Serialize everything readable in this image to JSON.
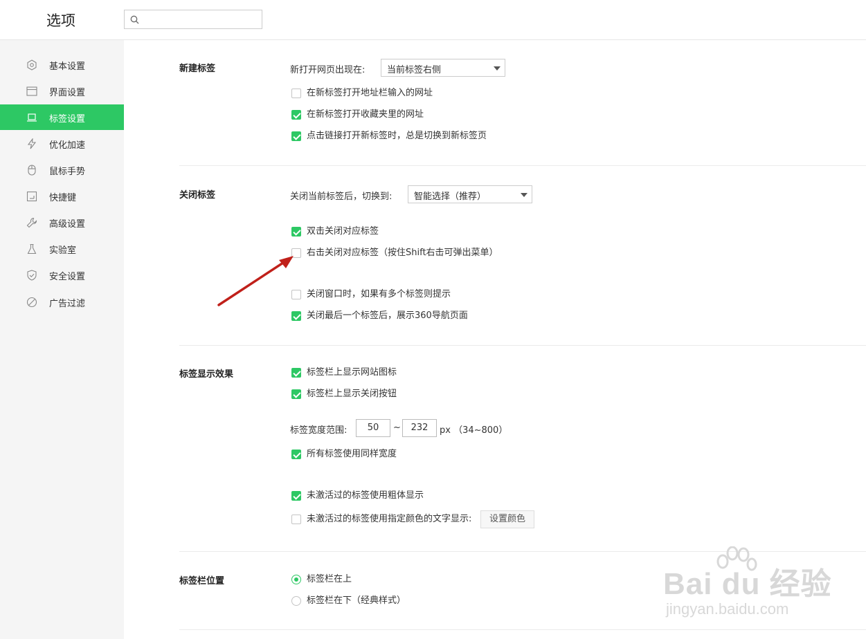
{
  "header": {
    "title": "选项",
    "search": {
      "placeholder": ""
    }
  },
  "sidebar": {
    "items": [
      {
        "label": "基本设置",
        "icon": "settings-icon"
      },
      {
        "label": "界面设置",
        "icon": "window-icon"
      },
      {
        "label": "标签设置",
        "icon": "tab-icon",
        "active": true
      },
      {
        "label": "优化加速",
        "icon": "lightning-icon"
      },
      {
        "label": "鼠标手势",
        "icon": "mouse-icon"
      },
      {
        "label": "快捷键",
        "icon": "keyboard-icon"
      },
      {
        "label": "高级设置",
        "icon": "wrench-icon"
      },
      {
        "label": "实验室",
        "icon": "flask-icon"
      },
      {
        "label": "安全设置",
        "icon": "shield-icon"
      },
      {
        "label": "广告过滤",
        "icon": "block-icon"
      }
    ]
  },
  "sections": {
    "new_tab": {
      "title": "新建标签",
      "open_position_label": "新打开网页出现在:",
      "open_position_value": "当前标签右侧",
      "options": [
        {
          "label": "在新标签打开地址栏输入的网址",
          "checked": false
        },
        {
          "label": "在新标签打开收藏夹里的网址",
          "checked": true
        },
        {
          "label": "点击链接打开新标签时，总是切换到新标签页",
          "checked": true
        }
      ]
    },
    "close_tab": {
      "title": "关闭标签",
      "switch_label": "关闭当前标签后，切换到:",
      "switch_value": "智能选择（推荐）",
      "options": [
        {
          "label": "双击关闭对应标签",
          "checked": true
        },
        {
          "label": "右击关闭对应标签（按住Shift右击可弹出菜单）",
          "checked": false
        },
        {
          "label": "关闭窗口时，如果有多个标签则提示",
          "checked": false
        },
        {
          "label": "关闭最后一个标签后，展示360导航页面",
          "checked": true
        }
      ]
    },
    "display": {
      "title": "标签显示效果",
      "options": [
        {
          "label": "标签栏上显示网站图标",
          "checked": true
        },
        {
          "label": "标签栏上显示关闭按钮",
          "checked": true
        }
      ],
      "width_label": "标签宽度范围:",
      "width_min": "50",
      "width_sep": "~",
      "width_max": "232",
      "width_unit": "px （34~800）",
      "same_width": {
        "label": "所有标签使用同样宽度",
        "checked": true
      },
      "bold_inactive": {
        "label": "未激活过的标签使用粗体显示",
        "checked": true
      },
      "color_inactive": {
        "label": "未激活过的标签使用指定颜色的文字显示:",
        "checked": false
      },
      "color_button": "设置颜色"
    },
    "position": {
      "title": "标签栏位置",
      "options": [
        {
          "label": "标签栏在上",
          "selected": true
        },
        {
          "label": "标签栏在下（经典样式）",
          "selected": false
        }
      ]
    }
  },
  "watermark": {
    "main": "Bai du 经验",
    "sub": "jingyan.baidu.com"
  },
  "colors": {
    "accent": "#2dc864",
    "annotation_arrow": "#c0201a"
  }
}
